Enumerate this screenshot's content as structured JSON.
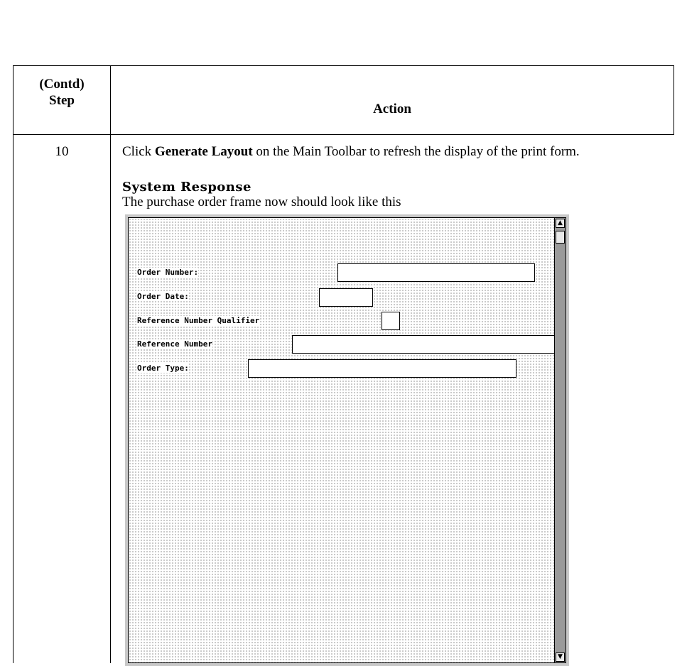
{
  "table": {
    "step_header_line1": "(Contd)",
    "step_header_line2": "Step",
    "action_header": "Action"
  },
  "row": {
    "step_number": "10",
    "instruction_prefix": "Click ",
    "instruction_bold": "Generate Layout",
    "instruction_suffix": " on the Main Toolbar to refresh the display of the print form.",
    "response_heading": "System Response",
    "response_text": "The purchase order frame now should look like this"
  },
  "form": {
    "fields": [
      {
        "label": "Order Number:"
      },
      {
        "label": "Order Date:"
      },
      {
        "label": "Reference Number Qualifier"
      },
      {
        "label": "Reference Number"
      },
      {
        "label": "Order Type:"
      }
    ],
    "scroll_up_icon": "arrow-up-icon",
    "scroll_down_icon": "arrow-down-icon"
  }
}
